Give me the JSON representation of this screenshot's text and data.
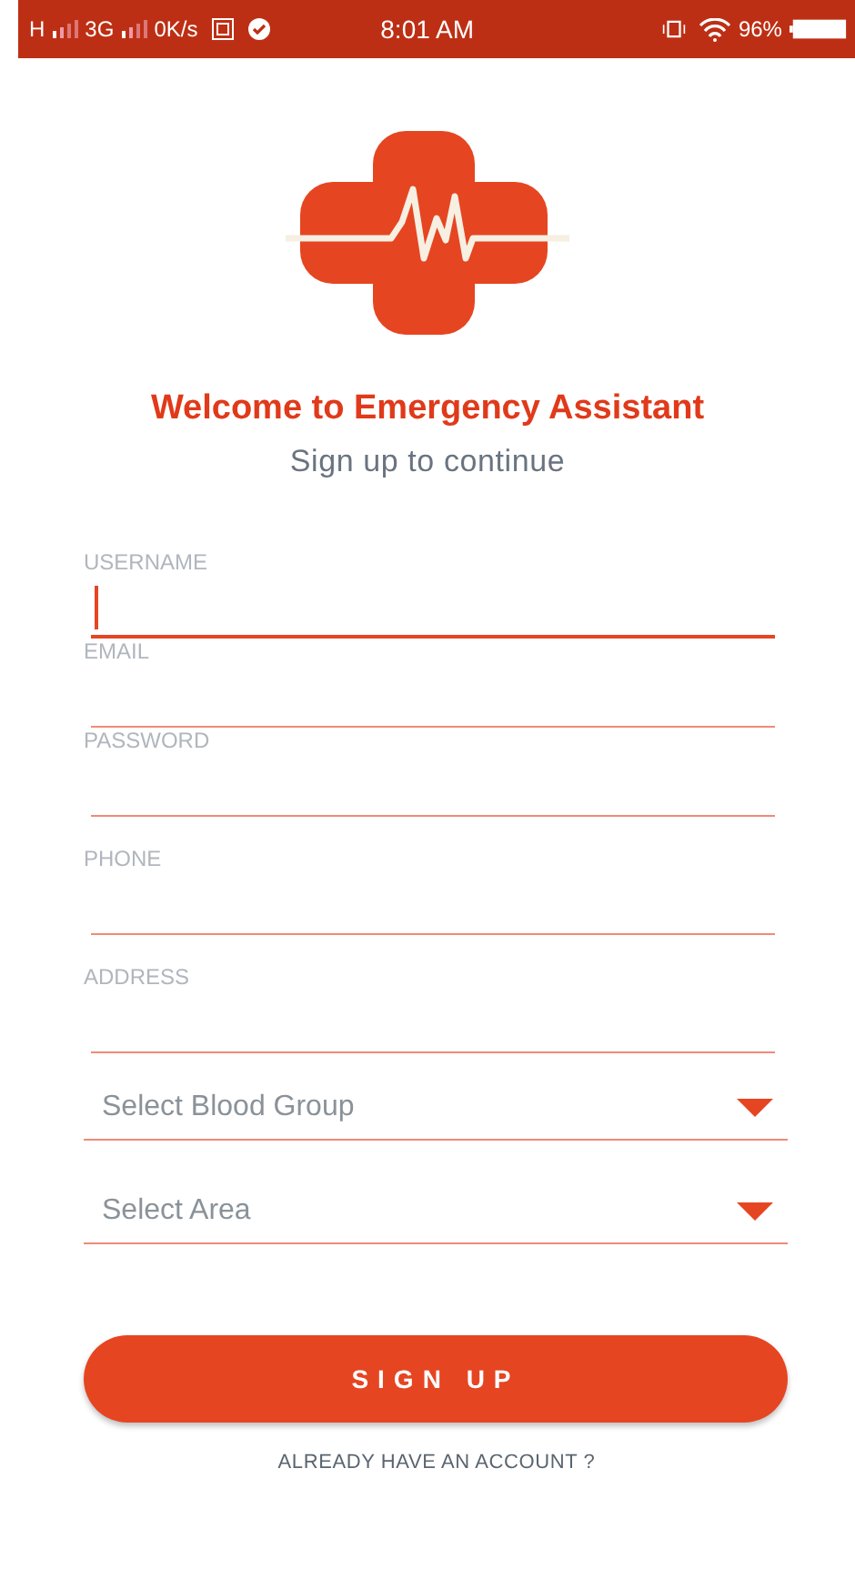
{
  "status_bar": {
    "network_1": "H",
    "network_2": "3G",
    "speed": "0K/s",
    "time": "8:01 AM",
    "battery": "96%"
  },
  "title": "Welcome to Emergency Assistant",
  "subtitle": "Sign up to continue",
  "fields": [
    {
      "label": "USERNAME",
      "focused": true
    },
    {
      "label": "EMAIL",
      "focused": false
    },
    {
      "label": "PASSWORD",
      "focused": false
    },
    {
      "label": "PHONE",
      "focused": false
    },
    {
      "label": "ADDRESS",
      "focused": false
    }
  ],
  "dropdowns": [
    {
      "placeholder": "Select Blood Group"
    },
    {
      "placeholder": "Select Area"
    }
  ],
  "button": "SIGN UP",
  "link": "ALREADY HAVE AN ACCOUNT ?"
}
